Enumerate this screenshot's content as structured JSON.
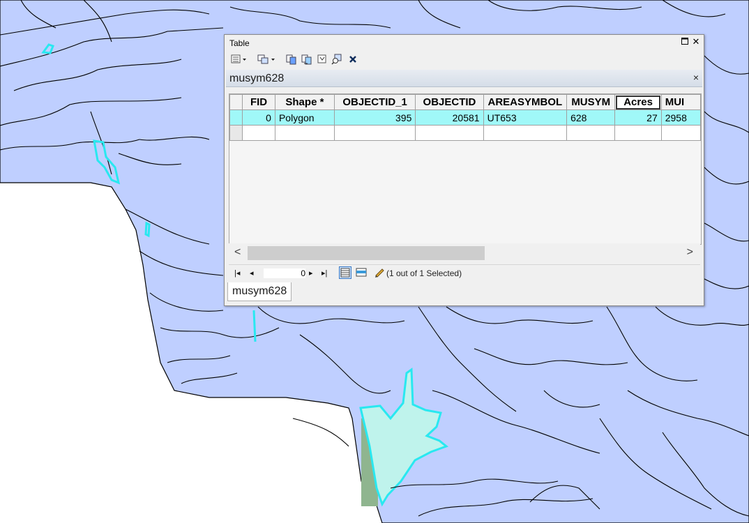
{
  "window": {
    "title": "Table",
    "restore_icon": "restore-icon",
    "close_icon": "close-icon"
  },
  "toolbar": {
    "icons": [
      "table-options-icon",
      "related-tables-icon",
      "select-by-attributes-icon",
      "switch-selection-icon",
      "clear-selection-icon",
      "zoom-to-selected-icon",
      "delete-selected-icon"
    ]
  },
  "tab": {
    "name": "musym628",
    "close": "×"
  },
  "grid": {
    "columns": [
      "FID",
      "Shape *",
      "OBJECTID_1",
      "OBJECTID",
      "AREASYMBOL",
      "MUSYM",
      "Acres",
      "MUI"
    ],
    "rows": [
      [
        "0",
        "Polygon",
        "395",
        "20581",
        "UT653",
        "628",
        "27",
        "2958"
      ]
    ]
  },
  "scroll": {
    "left": "<",
    "right": ">"
  },
  "nav": {
    "first": "|◂",
    "prev": "◂",
    "record": "0",
    "next": "▸",
    "last": "▸|",
    "status": "(1 out of 1 Selected)"
  },
  "bottom_tab": "musym628",
  "colors": {
    "map_fill": "#bfcfff",
    "selected_outline": "#29e8f0",
    "selected_row": "#a0f8f8",
    "highlight_fill": "#bff3ec"
  }
}
